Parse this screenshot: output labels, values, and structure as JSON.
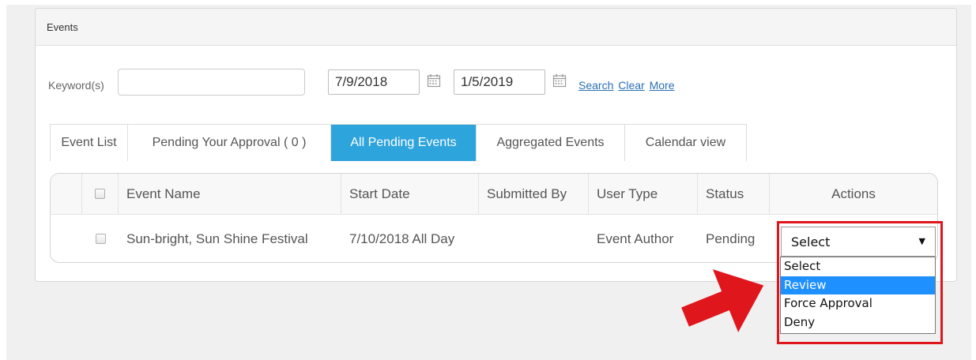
{
  "panel": {
    "title": "Events"
  },
  "filters": {
    "keyword_label": "Keyword(s)",
    "keyword_value": "",
    "start_date": "7/9/2018",
    "end_date": "1/5/2019",
    "search_link": "Search",
    "clear_link": "Clear",
    "more_link": "More",
    "calendar_icon": "calendar-icon"
  },
  "tabs": [
    {
      "label": "Event List",
      "active": false
    },
    {
      "label": "Pending Your Approval ( 0 )",
      "active": false
    },
    {
      "label": "All Pending Events",
      "active": true
    },
    {
      "label": "Aggregated Events",
      "active": false
    },
    {
      "label": "Calendar view",
      "active": false
    }
  ],
  "table": {
    "columns": [
      "Event Name",
      "Start Date",
      "Submitted By",
      "User Type",
      "Status",
      "Actions"
    ],
    "rows": [
      {
        "event_name": "Sun-bright, Sun Shine Festival",
        "start_date": "7/10/2018 All Day",
        "submitted_by": "",
        "user_type": "Event Author",
        "status": "Pending"
      }
    ]
  },
  "actions_select": {
    "selected": "Select",
    "options": [
      "Select",
      "Review",
      "Force Approval",
      "Deny"
    ],
    "highlighted": "Review"
  },
  "colors": {
    "active_tab": "#2ea4dc",
    "link": "#2a6fb4",
    "highlight_option": "#1e90ff",
    "annotation_red": "#e0161d"
  }
}
